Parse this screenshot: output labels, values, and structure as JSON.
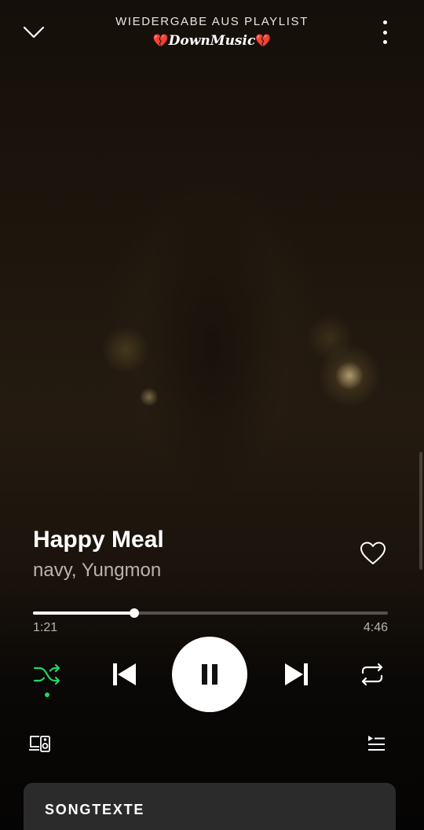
{
  "header": {
    "context_label": "WIEDERGABE AUS PLAYLIST",
    "playlist_name": "DownMusic",
    "playlist_emoji": "💔",
    "collapse_icon": "chevron-down-icon",
    "more_icon": "more-vertical-icon"
  },
  "track": {
    "title": "Happy Meal",
    "artists": "navy, Yungmon",
    "liked": false
  },
  "playback": {
    "current_time": "1:21",
    "total_time": "4:46",
    "progress_fraction": 0.286,
    "is_playing": true,
    "shuffle_enabled": true,
    "repeat_enabled": false
  },
  "controls": {
    "shuffle_icon": "shuffle-icon",
    "previous_icon": "skip-previous-icon",
    "pause_icon": "pause-icon",
    "next_icon": "skip-next-icon",
    "repeat_icon": "repeat-icon",
    "devices_icon": "devices-icon",
    "queue_icon": "queue-icon"
  },
  "lyrics": {
    "title": "SONGTEXTE"
  },
  "colors": {
    "accent": "#1ed760",
    "text_secondary": "#b9b4ad",
    "lyrics_card": "#2b2b2b"
  }
}
